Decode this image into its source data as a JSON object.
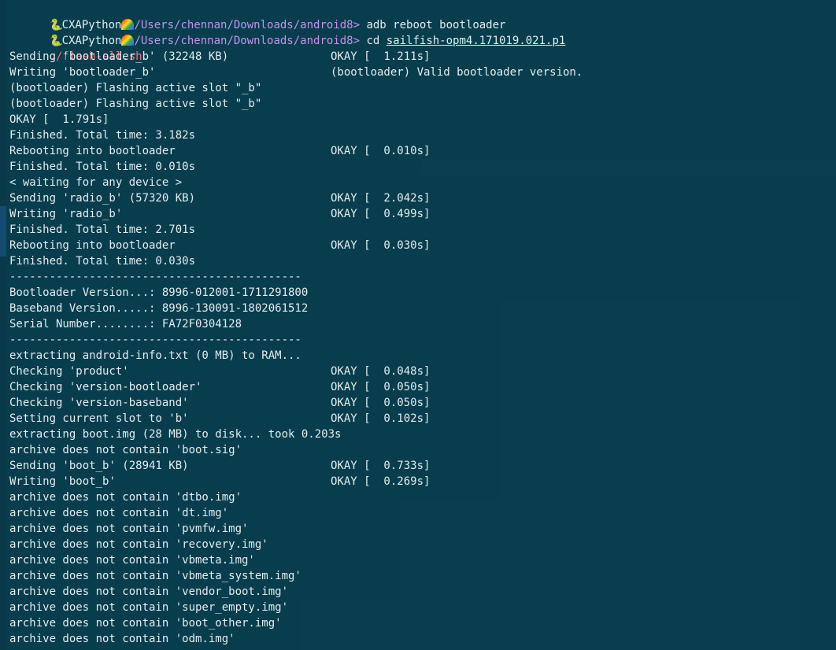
{
  "terminal": {
    "prompts": [
      {
        "user": "CXAPython",
        "path": "/Users/chennan/Downloads/android8>",
        "cmd": "adb reboot bootloader",
        "arg": ""
      },
      {
        "user": "CXAPython",
        "path": "/Users/chennan/Downloads/android8>",
        "cmd": "cd ",
        "arg": "sailfish-opm4.171019.021.p1"
      }
    ],
    "script": "./flash-all.sh",
    "lines": [
      {
        "l": "Sending 'bootloader_b' (32248 KB)",
        "r": "OKAY [  1.211s]"
      },
      {
        "l": "Writing 'bootloader_b'",
        "r": "(bootloader) Valid bootloader version."
      },
      {
        "l": "(bootloader) Flashing active slot \"_b\"",
        "r": ""
      },
      {
        "l": "(bootloader) Flashing active slot \"_b\"",
        "r": ""
      },
      {
        "l": "OKAY [  1.791s]",
        "r": ""
      },
      {
        "l": "Finished. Total time: 3.182s",
        "r": ""
      },
      {
        "l": "Rebooting into bootloader",
        "r": "OKAY [  0.010s]"
      },
      {
        "l": "Finished. Total time: 0.010s",
        "r": ""
      },
      {
        "l": "< waiting for any device >",
        "r": ""
      },
      {
        "l": "Sending 'radio_b' (57320 KB)",
        "r": "OKAY [  2.042s]"
      },
      {
        "l": "Writing 'radio_b'",
        "r": "OKAY [  0.499s]"
      },
      {
        "l": "Finished. Total time: 2.701s",
        "r": ""
      },
      {
        "l": "Rebooting into bootloader",
        "r": "OKAY [  0.030s]"
      },
      {
        "l": "Finished. Total time: 0.030s",
        "r": ""
      },
      {
        "l": "--------------------------------------------",
        "r": ""
      },
      {
        "l": "Bootloader Version...: 8996-012001-1711291800",
        "r": ""
      },
      {
        "l": "Baseband Version.....: 8996-130091-1802061512",
        "r": ""
      },
      {
        "l": "Serial Number........: FA72F0304128",
        "r": ""
      },
      {
        "l": "--------------------------------------------",
        "r": ""
      },
      {
        "l": "extracting android-info.txt (0 MB) to RAM...",
        "r": ""
      },
      {
        "l": "Checking 'product'",
        "r": "OKAY [  0.048s]"
      },
      {
        "l": "Checking 'version-bootloader'",
        "r": "OKAY [  0.050s]"
      },
      {
        "l": "Checking 'version-baseband'",
        "r": "OKAY [  0.050s]"
      },
      {
        "l": "Setting current slot to 'b'",
        "r": "OKAY [  0.102s]"
      },
      {
        "l": "extracting boot.img (28 MB) to disk... took 0.203s",
        "r": ""
      },
      {
        "l": "archive does not contain 'boot.sig'",
        "r": ""
      },
      {
        "l": "Sending 'boot_b' (28941 KB)",
        "r": "OKAY [  0.733s]"
      },
      {
        "l": "Writing 'boot_b'",
        "r": "OKAY [  0.269s]"
      },
      {
        "l": "archive does not contain 'dtbo.img'",
        "r": ""
      },
      {
        "l": "archive does not contain 'dt.img'",
        "r": ""
      },
      {
        "l": "archive does not contain 'pvmfw.img'",
        "r": ""
      },
      {
        "l": "archive does not contain 'recovery.img'",
        "r": ""
      },
      {
        "l": "archive does not contain 'vbmeta.img'",
        "r": ""
      },
      {
        "l": "archive does not contain 'vbmeta_system.img'",
        "r": ""
      },
      {
        "l": "archive does not contain 'vendor_boot.img'",
        "r": ""
      },
      {
        "l": "archive does not contain 'super_empty.img'",
        "r": ""
      },
      {
        "l": "archive does not contain 'boot_other.img'",
        "r": ""
      },
      {
        "l": "archive does not contain 'odm.img'",
        "r": ""
      }
    ]
  },
  "colors": {
    "background": "#0a3a4a",
    "text": "#e4ecee",
    "path": "#c792ea",
    "script": "#f07178"
  },
  "icons": [
    "python-icon",
    "rainbow-icon"
  ]
}
